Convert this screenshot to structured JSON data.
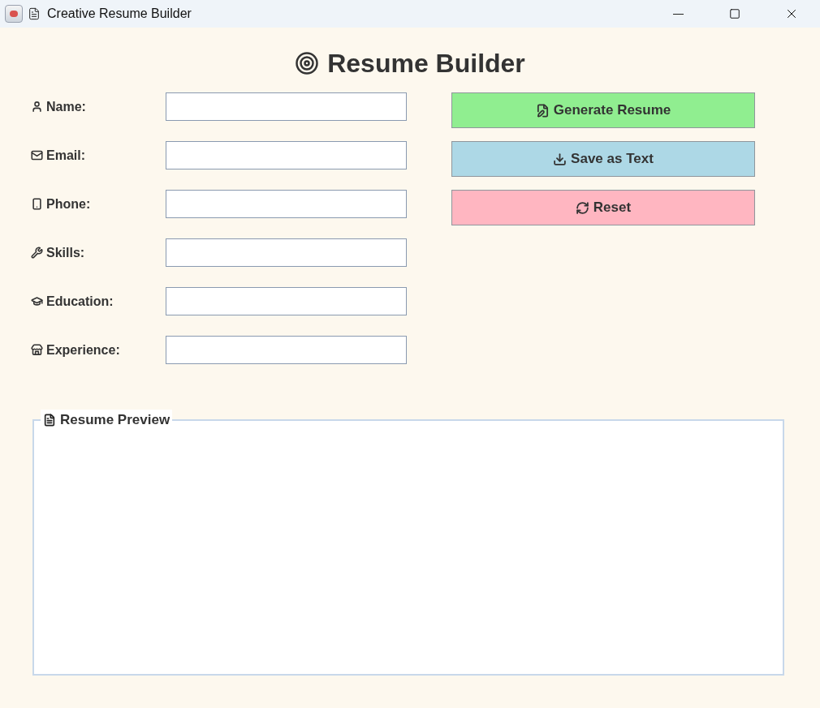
{
  "window": {
    "title": "Creative Resume Builder"
  },
  "heading": "Resume Builder",
  "fields": [
    {
      "kind": "name",
      "label": "Name:"
    },
    {
      "kind": "email",
      "label": "Email:"
    },
    {
      "kind": "phone",
      "label": "Phone:"
    },
    {
      "kind": "skills",
      "label": "Skills:"
    },
    {
      "kind": "education",
      "label": "Education:"
    },
    {
      "kind": "experience",
      "label": "Experience:"
    }
  ],
  "buttons": [
    {
      "kind": "generate",
      "label": "Generate Resume",
      "color": "#90ee90"
    },
    {
      "kind": "save",
      "label": "Save as Text",
      "color": "#add8e6"
    },
    {
      "kind": "reset",
      "label": "Reset",
      "color": "#ffb6c1"
    }
  ],
  "preview": {
    "title": "Resume Preview"
  }
}
